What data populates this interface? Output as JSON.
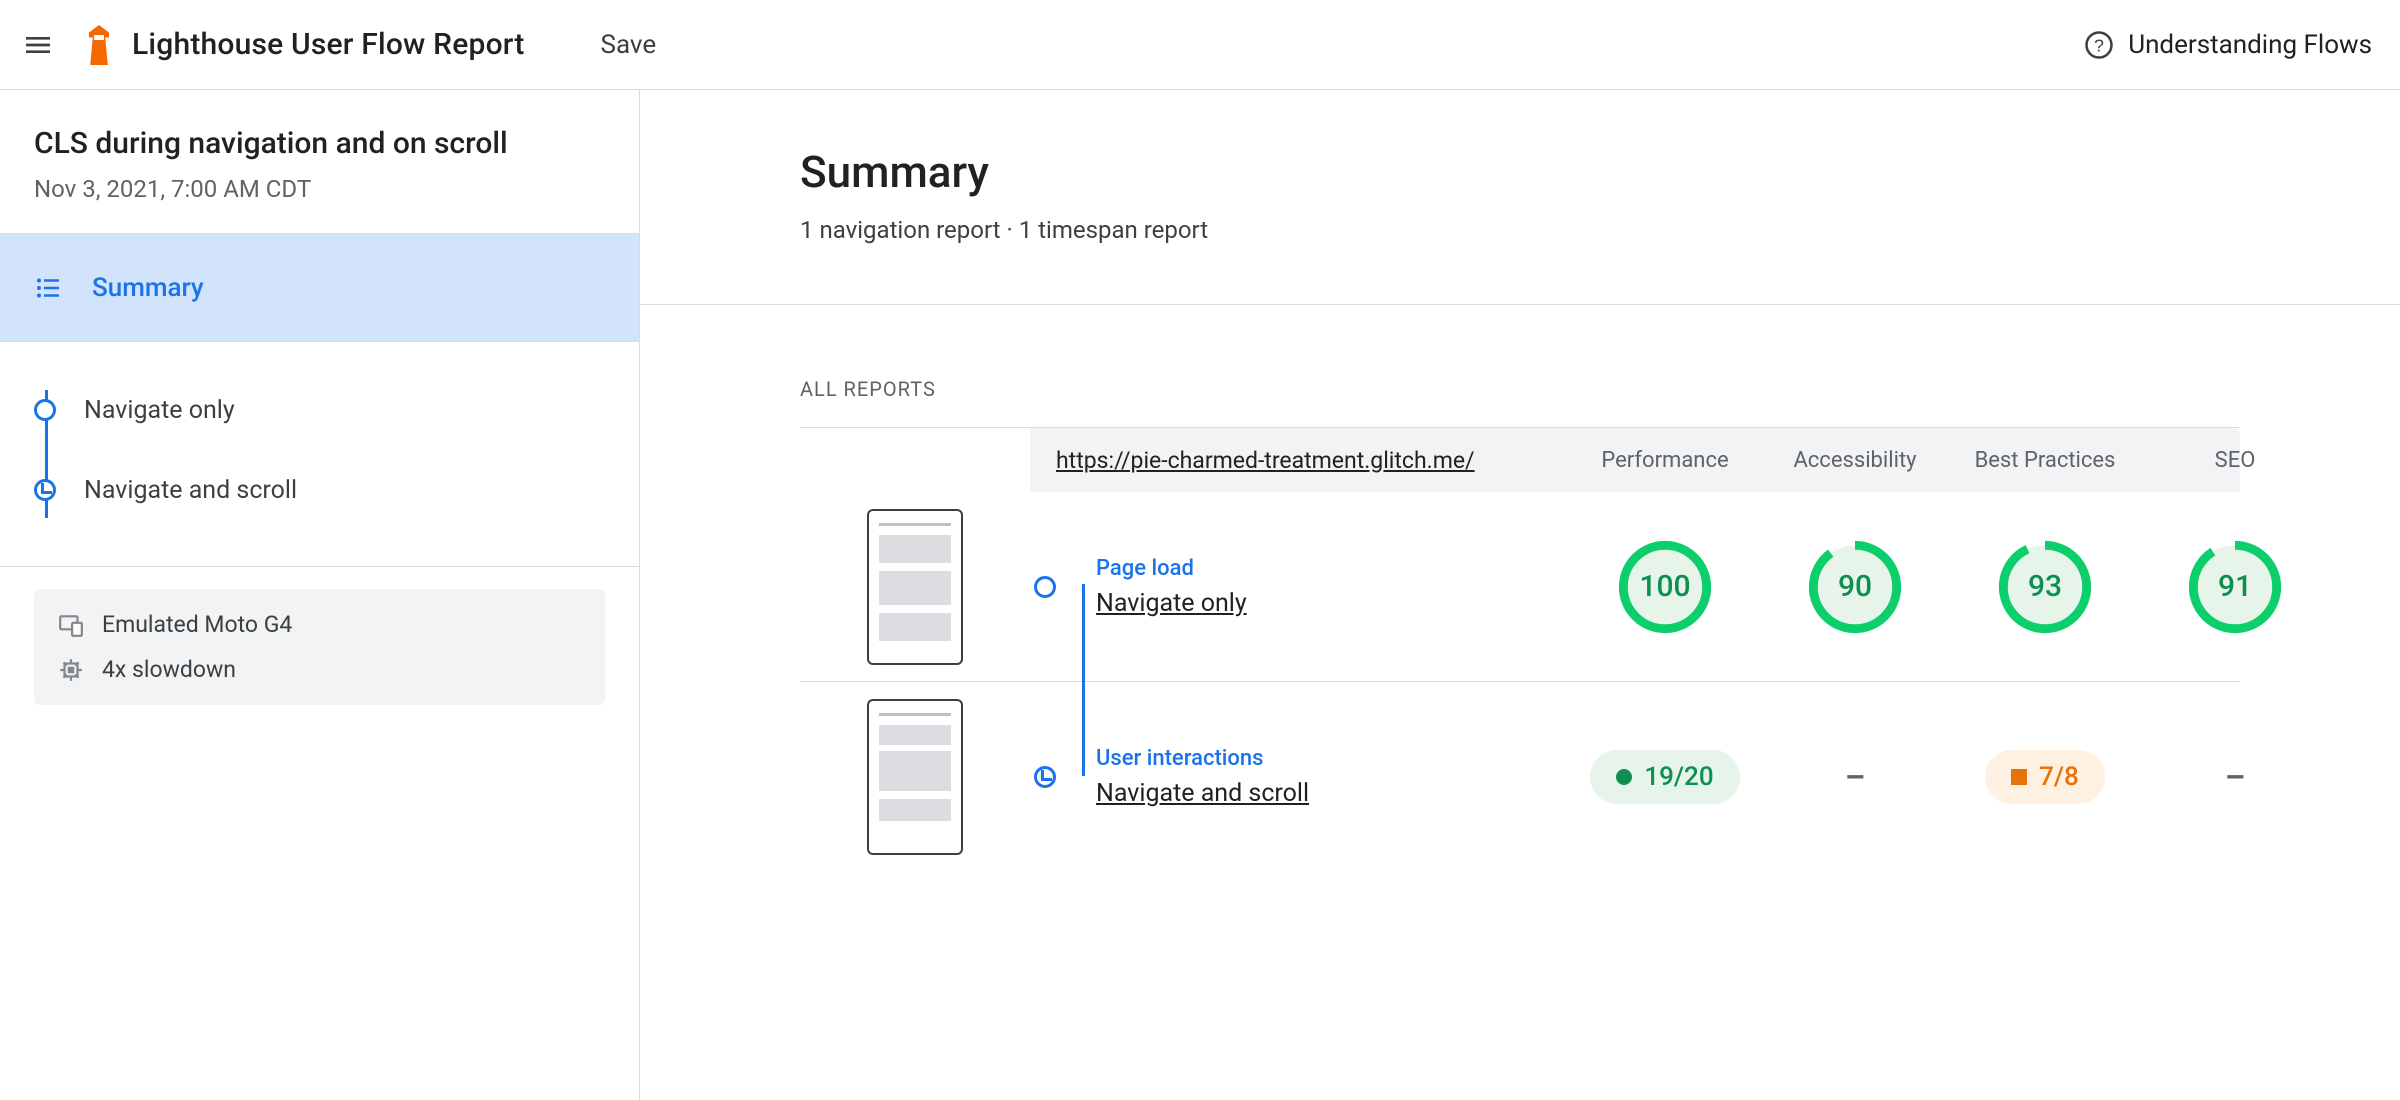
{
  "topbar": {
    "title": "Lighthouse User Flow Report",
    "save": "Save",
    "help": "Understanding Flows"
  },
  "sidebar": {
    "flow_title": "CLS during navigation and on scroll",
    "timestamp": "Nov 3, 2021, 7:00 AM CDT",
    "summary_label": "Summary",
    "steps": [
      {
        "label": "Navigate only",
        "kind": "navigation"
      },
      {
        "label": "Navigate and scroll",
        "kind": "timespan"
      }
    ],
    "env": {
      "device": "Emulated Moto G4",
      "throttle": "4x slowdown"
    }
  },
  "main": {
    "heading": "Summary",
    "subtitle": "1 navigation report · 1 timespan report",
    "all_reports_label": "ALL REPORTS",
    "url": "https://pie-charmed-treatment.glitch.me/",
    "columns": {
      "performance": "Performance",
      "accessibility": "Accessibility",
      "best_practices": "Best Practices",
      "seo": "SEO"
    },
    "rows": [
      {
        "kind_label": "Page load",
        "name": "Navigate only",
        "marker": "navigation",
        "scores": {
          "performance": {
            "type": "gauge",
            "value": 100,
            "pct": 100,
            "color": "#0cce6b",
            "bg": "#e6f4ea"
          },
          "accessibility": {
            "type": "gauge",
            "value": 90,
            "pct": 90,
            "color": "#0cce6b",
            "bg": "#e6f4ea"
          },
          "best_practices": {
            "type": "gauge",
            "value": 93,
            "pct": 93,
            "color": "#0cce6b",
            "bg": "#e6f4ea"
          },
          "seo": {
            "type": "gauge",
            "value": 91,
            "pct": 91,
            "color": "#0cce6b",
            "bg": "#e6f4ea"
          }
        }
      },
      {
        "kind_label": "User interactions",
        "name": "Navigate and scroll",
        "marker": "timespan",
        "scores": {
          "performance": {
            "type": "pill",
            "text": "19/20",
            "tone": "green"
          },
          "accessibility": {
            "type": "dash"
          },
          "best_practices": {
            "type": "pill",
            "text": "7/8",
            "tone": "orange"
          },
          "seo": {
            "type": "dash"
          }
        }
      }
    ]
  },
  "colors": {
    "blue": "#1a73e8",
    "green": "#0cce6b",
    "orange": "#e8710a"
  }
}
